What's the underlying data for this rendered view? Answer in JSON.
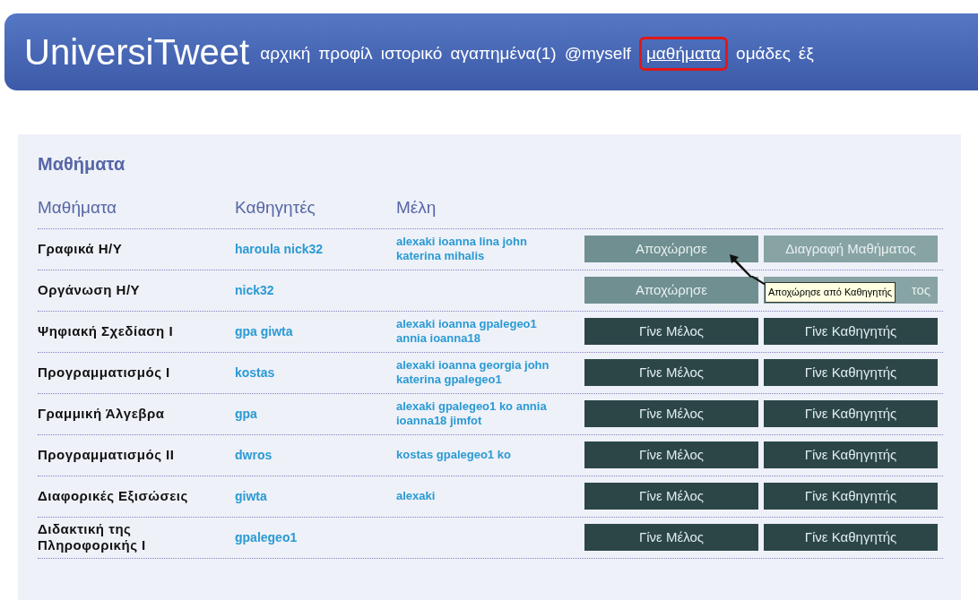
{
  "header": {
    "title": "UniversiTweet",
    "nav": [
      {
        "label": "αρχική",
        "selected": false
      },
      {
        "label": "προφίλ",
        "selected": false
      },
      {
        "label": "ιστορικό",
        "selected": false
      },
      {
        "label": "αγαπημένα(1)",
        "selected": false
      },
      {
        "label": "@myself",
        "selected": false
      },
      {
        "label": "μαθήματα",
        "selected": true
      },
      {
        "label": "ομάδες",
        "selected": false
      },
      {
        "label": "έξ",
        "selected": false
      }
    ]
  },
  "panel": {
    "title": "Μαθήματα",
    "columns": [
      "Μαθήματα",
      "Καθηγητές",
      "Μέλη"
    ],
    "rows": [
      {
        "course": "Γραφικά Η/Υ",
        "teachers": "haroula nick32",
        "members": "alexaki ioanna lina john katerina mihalis",
        "actions": [
          {
            "kind": "leave",
            "label": "Αποχώρησε"
          },
          {
            "kind": "delete",
            "label": "Διαγραφή Μαθήματος"
          }
        ]
      },
      {
        "course": "Οργάνωση Η/Υ",
        "teachers": "nick32",
        "actions": [
          {
            "kind": "leave",
            "label": "Αποχώρησε"
          },
          {
            "kind": "delete",
            "label": "τος"
          }
        ]
      },
      {
        "course": "Ψηφιακή Σχεδίαση Ι",
        "teachers": "gpa giwta",
        "members": "alexaki ioanna gpalegeo1 annia ioanna18",
        "actions": [
          {
            "kind": "join",
            "label": "Γίνε Μέλος"
          },
          {
            "kind": "join",
            "label": "Γίνε Καθηγητής"
          }
        ]
      },
      {
        "course": "Προγραμματισμός Ι",
        "teachers": "kostas",
        "members": "alexaki ioanna georgia john katerina gpalegeo1",
        "actions": [
          {
            "kind": "join",
            "label": "Γίνε Μέλος"
          },
          {
            "kind": "join",
            "label": "Γίνε Καθηγητής"
          }
        ]
      },
      {
        "course": "Γραμμική Άλγεβρα",
        "teachers": "gpa",
        "members": "alexaki gpalegeo1 ko annia ioanna18 jimfot",
        "actions": [
          {
            "kind": "join",
            "label": "Γίνε Μέλος"
          },
          {
            "kind": "join",
            "label": "Γίνε Καθηγητής"
          }
        ]
      },
      {
        "course": "Προγραμματισμός ΙΙ",
        "teachers": "dwros",
        "members": "kostas gpalegeo1 ko",
        "actions": [
          {
            "kind": "join",
            "label": "Γίνε Μέλος"
          },
          {
            "kind": "join",
            "label": "Γίνε Καθηγητής"
          }
        ]
      },
      {
        "course": "Διαφορικές Εξισώσεις",
        "teachers": "giwta",
        "members": "alexaki",
        "actions": [
          {
            "kind": "join",
            "label": "Γίνε Μέλος"
          },
          {
            "kind": "join",
            "label": "Γίνε Καθηγητής"
          }
        ]
      },
      {
        "course": "Διδακτική της Πληροφορικής Ι",
        "teachers": "gpalegeo1",
        "actions": [
          {
            "kind": "join",
            "label": "Γίνε Μέλος"
          },
          {
            "kind": "join",
            "label": "Γίνε Καθηγητής"
          }
        ]
      }
    ]
  },
  "tooltip": {
    "text": "Αποχώρησε από Καθηγητής"
  }
}
